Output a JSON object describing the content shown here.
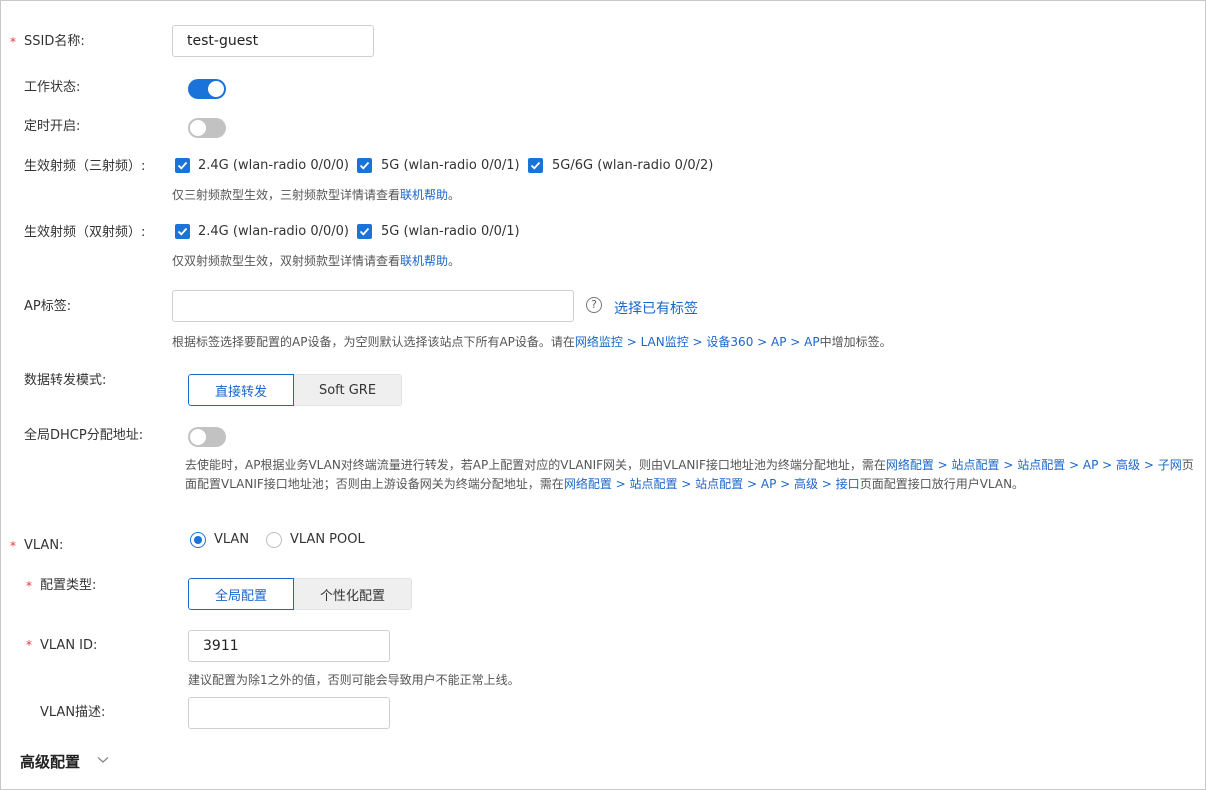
{
  "ssid": {
    "label": "SSID名称:",
    "value": "test-guest"
  },
  "work_status": {
    "label": "工作状态:",
    "on": true
  },
  "scheduled": {
    "label": "定时开启:",
    "on": false
  },
  "radio_tri": {
    "label": "生效射频（三射频）:",
    "options": [
      "2.4G (wlan-radio 0/0/0)",
      "5G (wlan-radio 0/0/1)",
      "5G/6G (wlan-radio 0/0/2)"
    ],
    "hint": "仅三射频款型生效，三射频款型详情请查看",
    "hint_link": "联机帮助",
    "hint_end": "。"
  },
  "radio_dual": {
    "label": "生效射频（双射频）:",
    "options": [
      "2.4G (wlan-radio 0/0/0)",
      "5G (wlan-radio 0/0/1)"
    ],
    "hint": "仅双射频款型生效，双射频款型详情请查看",
    "hint_link": "联机帮助",
    "hint_end": "。"
  },
  "ap_tag": {
    "label": "AP标签:",
    "value": "",
    "help_icon": "?",
    "select_link": "选择已有标签",
    "hint_pre": "根据标签选择要配置的AP设备，为空则默认选择该站点下所有AP设备。请在",
    "hint_link": "网络监控 > LAN监控 > 设备360 > AP > AP",
    "hint_post": "中增加标签。"
  },
  "forward_mode": {
    "label": "数据转发模式:",
    "options": [
      "直接转发",
      "Soft GRE"
    ]
  },
  "dhcp": {
    "label": "全局DHCP分配地址:",
    "on": false,
    "p1": "去使能时，AP根据业务VLAN对终端流量进行转发，若AP上配置对应的VLANIF网关，则由VLANIF接口地址池为终端分配地址，需在",
    "link1": "网络配置 > 站点配置 > 站点配置 > AP > 高级 > 子网",
    "p2": "页面配置VLANIF接口地址池；否则由上游设备网关为终端分配地址，需在",
    "link2": "网络配置 > 站点配置 > 站点配置 > AP > 高级 > 接口",
    "p3": "页面配置接口放行用户VLAN。"
  },
  "vlan": {
    "label": "VLAN:",
    "options": [
      "VLAN",
      "VLAN POOL"
    ]
  },
  "config_type": {
    "label": "配置类型:",
    "options": [
      "全局配置",
      "个性化配置"
    ]
  },
  "vlan_id": {
    "label": "VLAN ID:",
    "value": "3911",
    "hint": "建议配置为除1之外的值，否则可能会导致用户不能正常上线。"
  },
  "vlan_desc": {
    "label": "VLAN描述:",
    "value": ""
  },
  "advanced": {
    "label": "高级配置"
  },
  "colors": {
    "accent": "#1a73d9",
    "link": "#1a66c9",
    "required": "#e5393b"
  },
  "required_mark": "*"
}
